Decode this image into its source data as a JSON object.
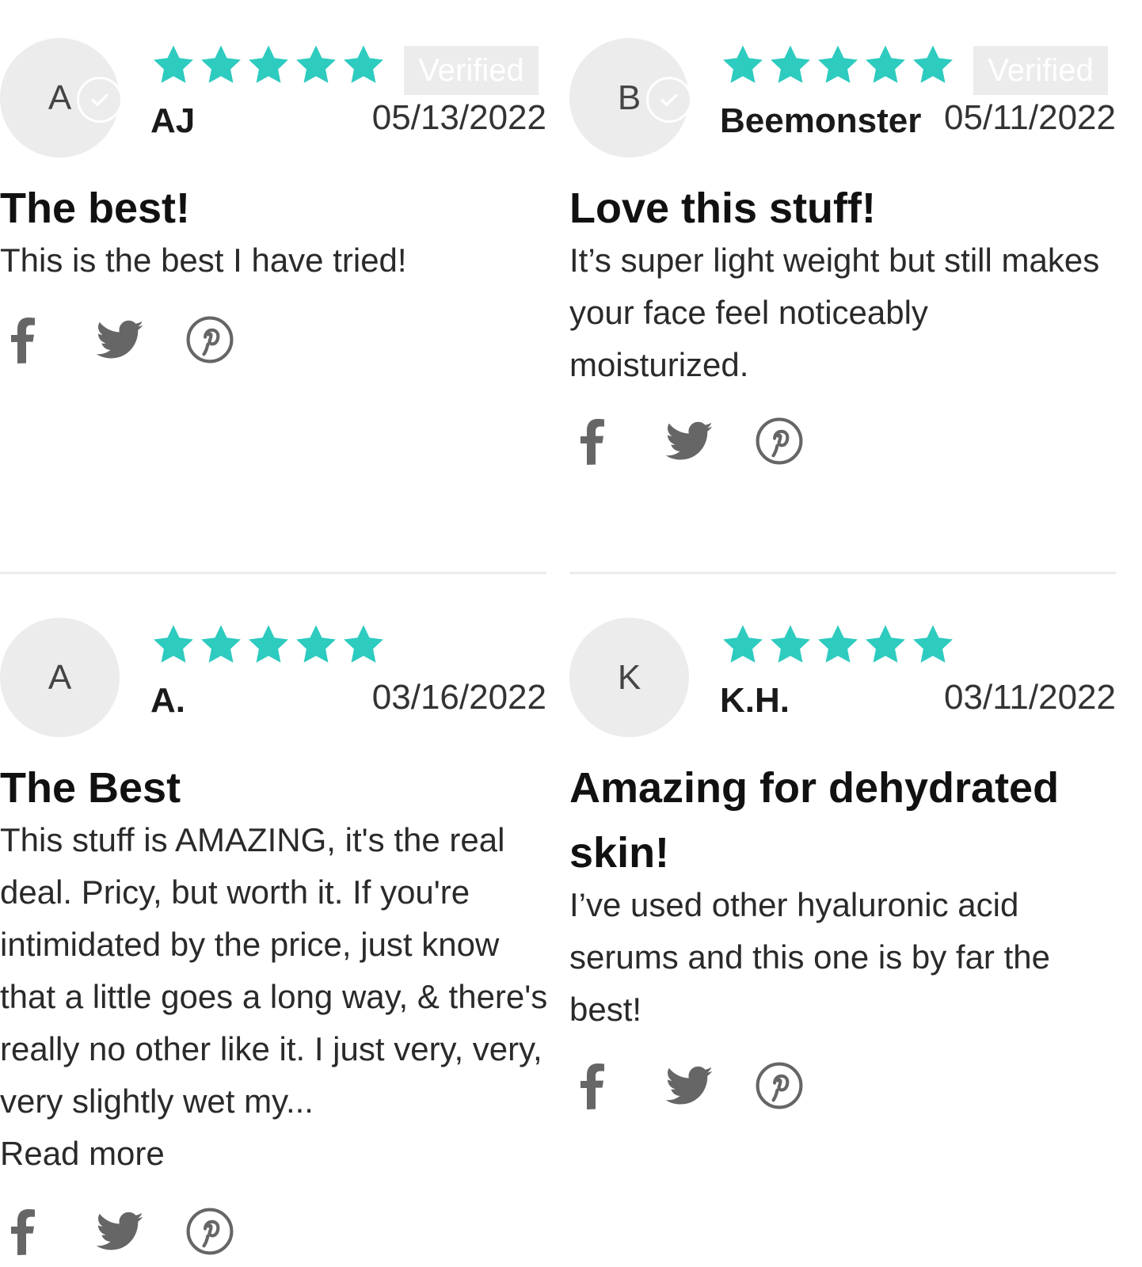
{
  "colors": {
    "star": "#2ecbbf",
    "avatar_bg": "#ececec",
    "icon": "#666666"
  },
  "reviews": [
    {
      "avatar_letter": "A",
      "avatar_verified": true,
      "rating": 5,
      "verified_label": "Verified",
      "author": "AJ",
      "date": "05/13/2022",
      "title": "The best!",
      "body": "This is the best I have tried!",
      "read_more": "",
      "share": [
        "facebook-icon",
        "twitter-icon",
        "pinterest-icon"
      ]
    },
    {
      "avatar_letter": "B",
      "avatar_verified": true,
      "rating": 5,
      "verified_label": "Verified",
      "author": "Beemonster",
      "date": "05/11/2022",
      "title": "Love this stuff!",
      "body": "It’s super light weight but still makes your face feel noticeably moisturized.",
      "read_more": "",
      "share": [
        "facebook-icon",
        "twitter-icon",
        "pinterest-icon"
      ]
    },
    {
      "avatar_letter": "A",
      "avatar_verified": false,
      "rating": 5,
      "verified_label": "",
      "author": "A.",
      "date": "03/16/2022",
      "title": "The Best",
      "body": "This stuff is AMAZING, it's the real deal. Pricy, but worth it. If you're intimidated by the price, just know that a little goes a long way, & there's really no other like it. I just very, very, very slightly wet my...",
      "read_more": "Read more",
      "share": [
        "facebook-icon",
        "twitter-icon",
        "pinterest-icon"
      ]
    },
    {
      "avatar_letter": "K",
      "avatar_verified": false,
      "rating": 5,
      "verified_label": "",
      "author": "K.H.",
      "date": "03/11/2022",
      "title": "Amazing for dehydrated skin!",
      "body": "I’ve used other hyaluronic acid serums and this one is by far the best!",
      "read_more": "",
      "share": [
        "facebook-icon",
        "twitter-icon",
        "pinterest-icon"
      ]
    }
  ]
}
